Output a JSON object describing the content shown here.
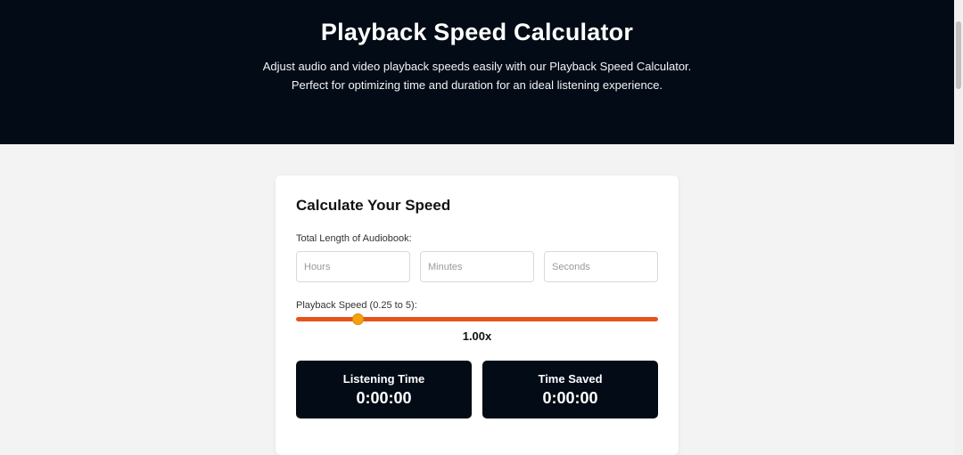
{
  "header": {
    "title": "Playback Speed Calculator",
    "description": "Adjust audio and video playback speeds easily with our Playback Speed Calculator. Perfect for optimizing time and duration for an ideal listening experience."
  },
  "card": {
    "title": "Calculate Your Speed",
    "length_label": "Total Length of Audiobook:",
    "inputs": {
      "hours_placeholder": "Hours",
      "minutes_placeholder": "Minutes",
      "seconds_placeholder": "Seconds"
    },
    "speed_label": "Playback Speed (0.25 to 5):",
    "speed": {
      "min": 0.25,
      "max": 5,
      "value": 1.0,
      "display": "1.00x"
    },
    "results": {
      "listening_title": "Listening Time",
      "listening_value": "0:00:00",
      "saved_title": "Time Saved",
      "saved_value": "0:00:00"
    }
  },
  "colors": {
    "header_bg": "#020b16",
    "slider_track": "#e7541a",
    "slider_thumb": "#f5a10f",
    "result_bg": "#020b16"
  }
}
